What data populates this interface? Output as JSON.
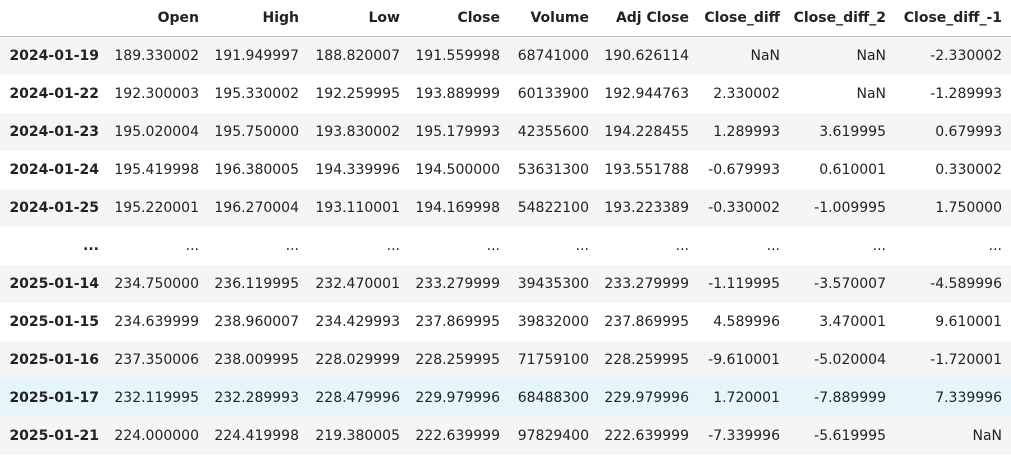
{
  "table": {
    "columns": [
      "",
      "Open",
      "High",
      "Low",
      "Close",
      "Volume",
      "Adj Close",
      "Close_diff",
      "Close_diff_2",
      "Close_diff_-1"
    ],
    "rows": [
      {
        "index": "2024-01-19",
        "cells": [
          "189.330002",
          "191.949997",
          "188.820007",
          "191.559998",
          "68741000",
          "190.626114",
          "NaN",
          "NaN",
          "-2.330002"
        ]
      },
      {
        "index": "2024-01-22",
        "cells": [
          "192.300003",
          "195.330002",
          "192.259995",
          "193.889999",
          "60133900",
          "192.944763",
          "2.330002",
          "NaN",
          "-1.289993"
        ]
      },
      {
        "index": "2024-01-23",
        "cells": [
          "195.020004",
          "195.750000",
          "193.830002",
          "195.179993",
          "42355600",
          "194.228455",
          "1.289993",
          "3.619995",
          "0.679993"
        ]
      },
      {
        "index": "2024-01-24",
        "cells": [
          "195.419998",
          "196.380005",
          "194.339996",
          "194.500000",
          "53631300",
          "193.551788",
          "-0.679993",
          "0.610001",
          "0.330002"
        ]
      },
      {
        "index": "2024-01-25",
        "cells": [
          "195.220001",
          "196.270004",
          "193.110001",
          "194.169998",
          "54822100",
          "193.223389",
          "-0.330002",
          "-1.009995",
          "1.750000"
        ]
      },
      {
        "index": "...",
        "cells": [
          "...",
          "...",
          "...",
          "...",
          "...",
          "...",
          "...",
          "...",
          "..."
        ]
      },
      {
        "index": "2025-01-14",
        "cells": [
          "234.750000",
          "236.119995",
          "232.470001",
          "233.279999",
          "39435300",
          "233.279999",
          "-1.119995",
          "-3.570007",
          "-4.589996"
        ]
      },
      {
        "index": "2025-01-15",
        "cells": [
          "234.639999",
          "238.960007",
          "234.429993",
          "237.869995",
          "39832000",
          "237.869995",
          "4.589996",
          "3.470001",
          "9.610001"
        ]
      },
      {
        "index": "2025-01-16",
        "cells": [
          "237.350006",
          "238.009995",
          "228.029999",
          "228.259995",
          "71759100",
          "228.259995",
          "-9.610001",
          "-5.020004",
          "-1.720001"
        ]
      },
      {
        "index": "2025-01-17",
        "cells": [
          "232.119995",
          "232.289993",
          "228.479996",
          "229.979996",
          "68488300",
          "229.979996",
          "1.720001",
          "-7.889999",
          "7.339996"
        ]
      },
      {
        "index": "2025-01-21",
        "cells": [
          "224.000000",
          "224.419998",
          "219.380005",
          "222.639999",
          "97829400",
          "222.639999",
          "-7.339996",
          "-5.619995",
          "NaN"
        ]
      }
    ],
    "highlighted_row": 9
  }
}
